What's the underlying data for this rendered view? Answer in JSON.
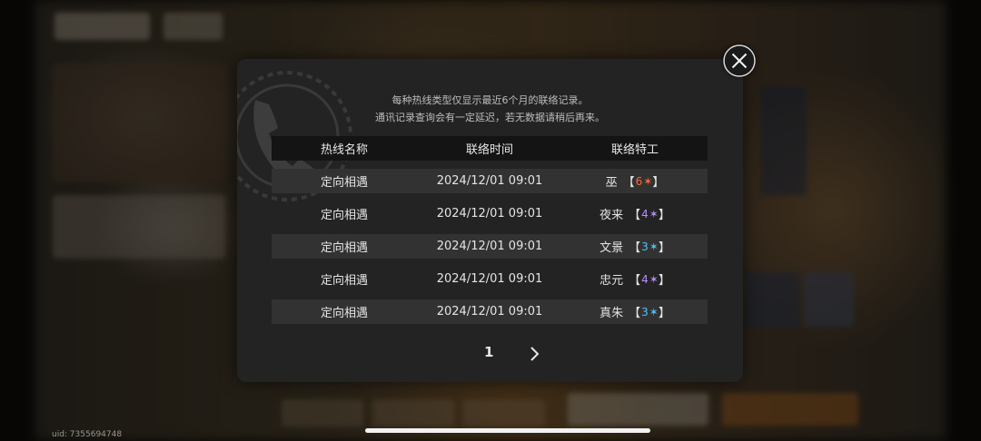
{
  "background": {
    "uid": "uid: 7355694748"
  },
  "dialog": {
    "notice_line1": "每种热线类型仅显示最近6个月的联络记录。",
    "notice_line2": "通讯记录查询会有一定延迟，若无数据请稍后再来。",
    "columns": [
      "热线名称",
      "联络时间",
      "联络特工"
    ],
    "rows": [
      {
        "hotline": "定向相遇",
        "time": "2024/12/01 09:01",
        "agent": "巫",
        "rank": "6",
        "star": "✶",
        "rank_color": "#ff6a33"
      },
      {
        "hotline": "定向相遇",
        "time": "2024/12/01 09:01",
        "agent": "夜来",
        "rank": "4",
        "star": "✶",
        "rank_color": "#b98cff"
      },
      {
        "hotline": "定向相遇",
        "time": "2024/12/01 09:01",
        "agent": "文景",
        "rank": "3",
        "star": "✶",
        "rank_color": "#4fc3ff"
      },
      {
        "hotline": "定向相遇",
        "time": "2024/12/01 09:01",
        "agent": "忠元",
        "rank": "4",
        "star": "✶",
        "rank_color": "#b98cff"
      },
      {
        "hotline": "定向相遇",
        "time": "2024/12/01 09:01",
        "agent": "真朱",
        "rank": "3",
        "star": "✶",
        "rank_color": "#4fc3ff"
      }
    ],
    "pager": {
      "current_page": "1",
      "next_icon": "chevron-right-icon"
    }
  },
  "close_icon": "close-icon",
  "brackets": {
    "open": "【",
    "close": "】"
  }
}
